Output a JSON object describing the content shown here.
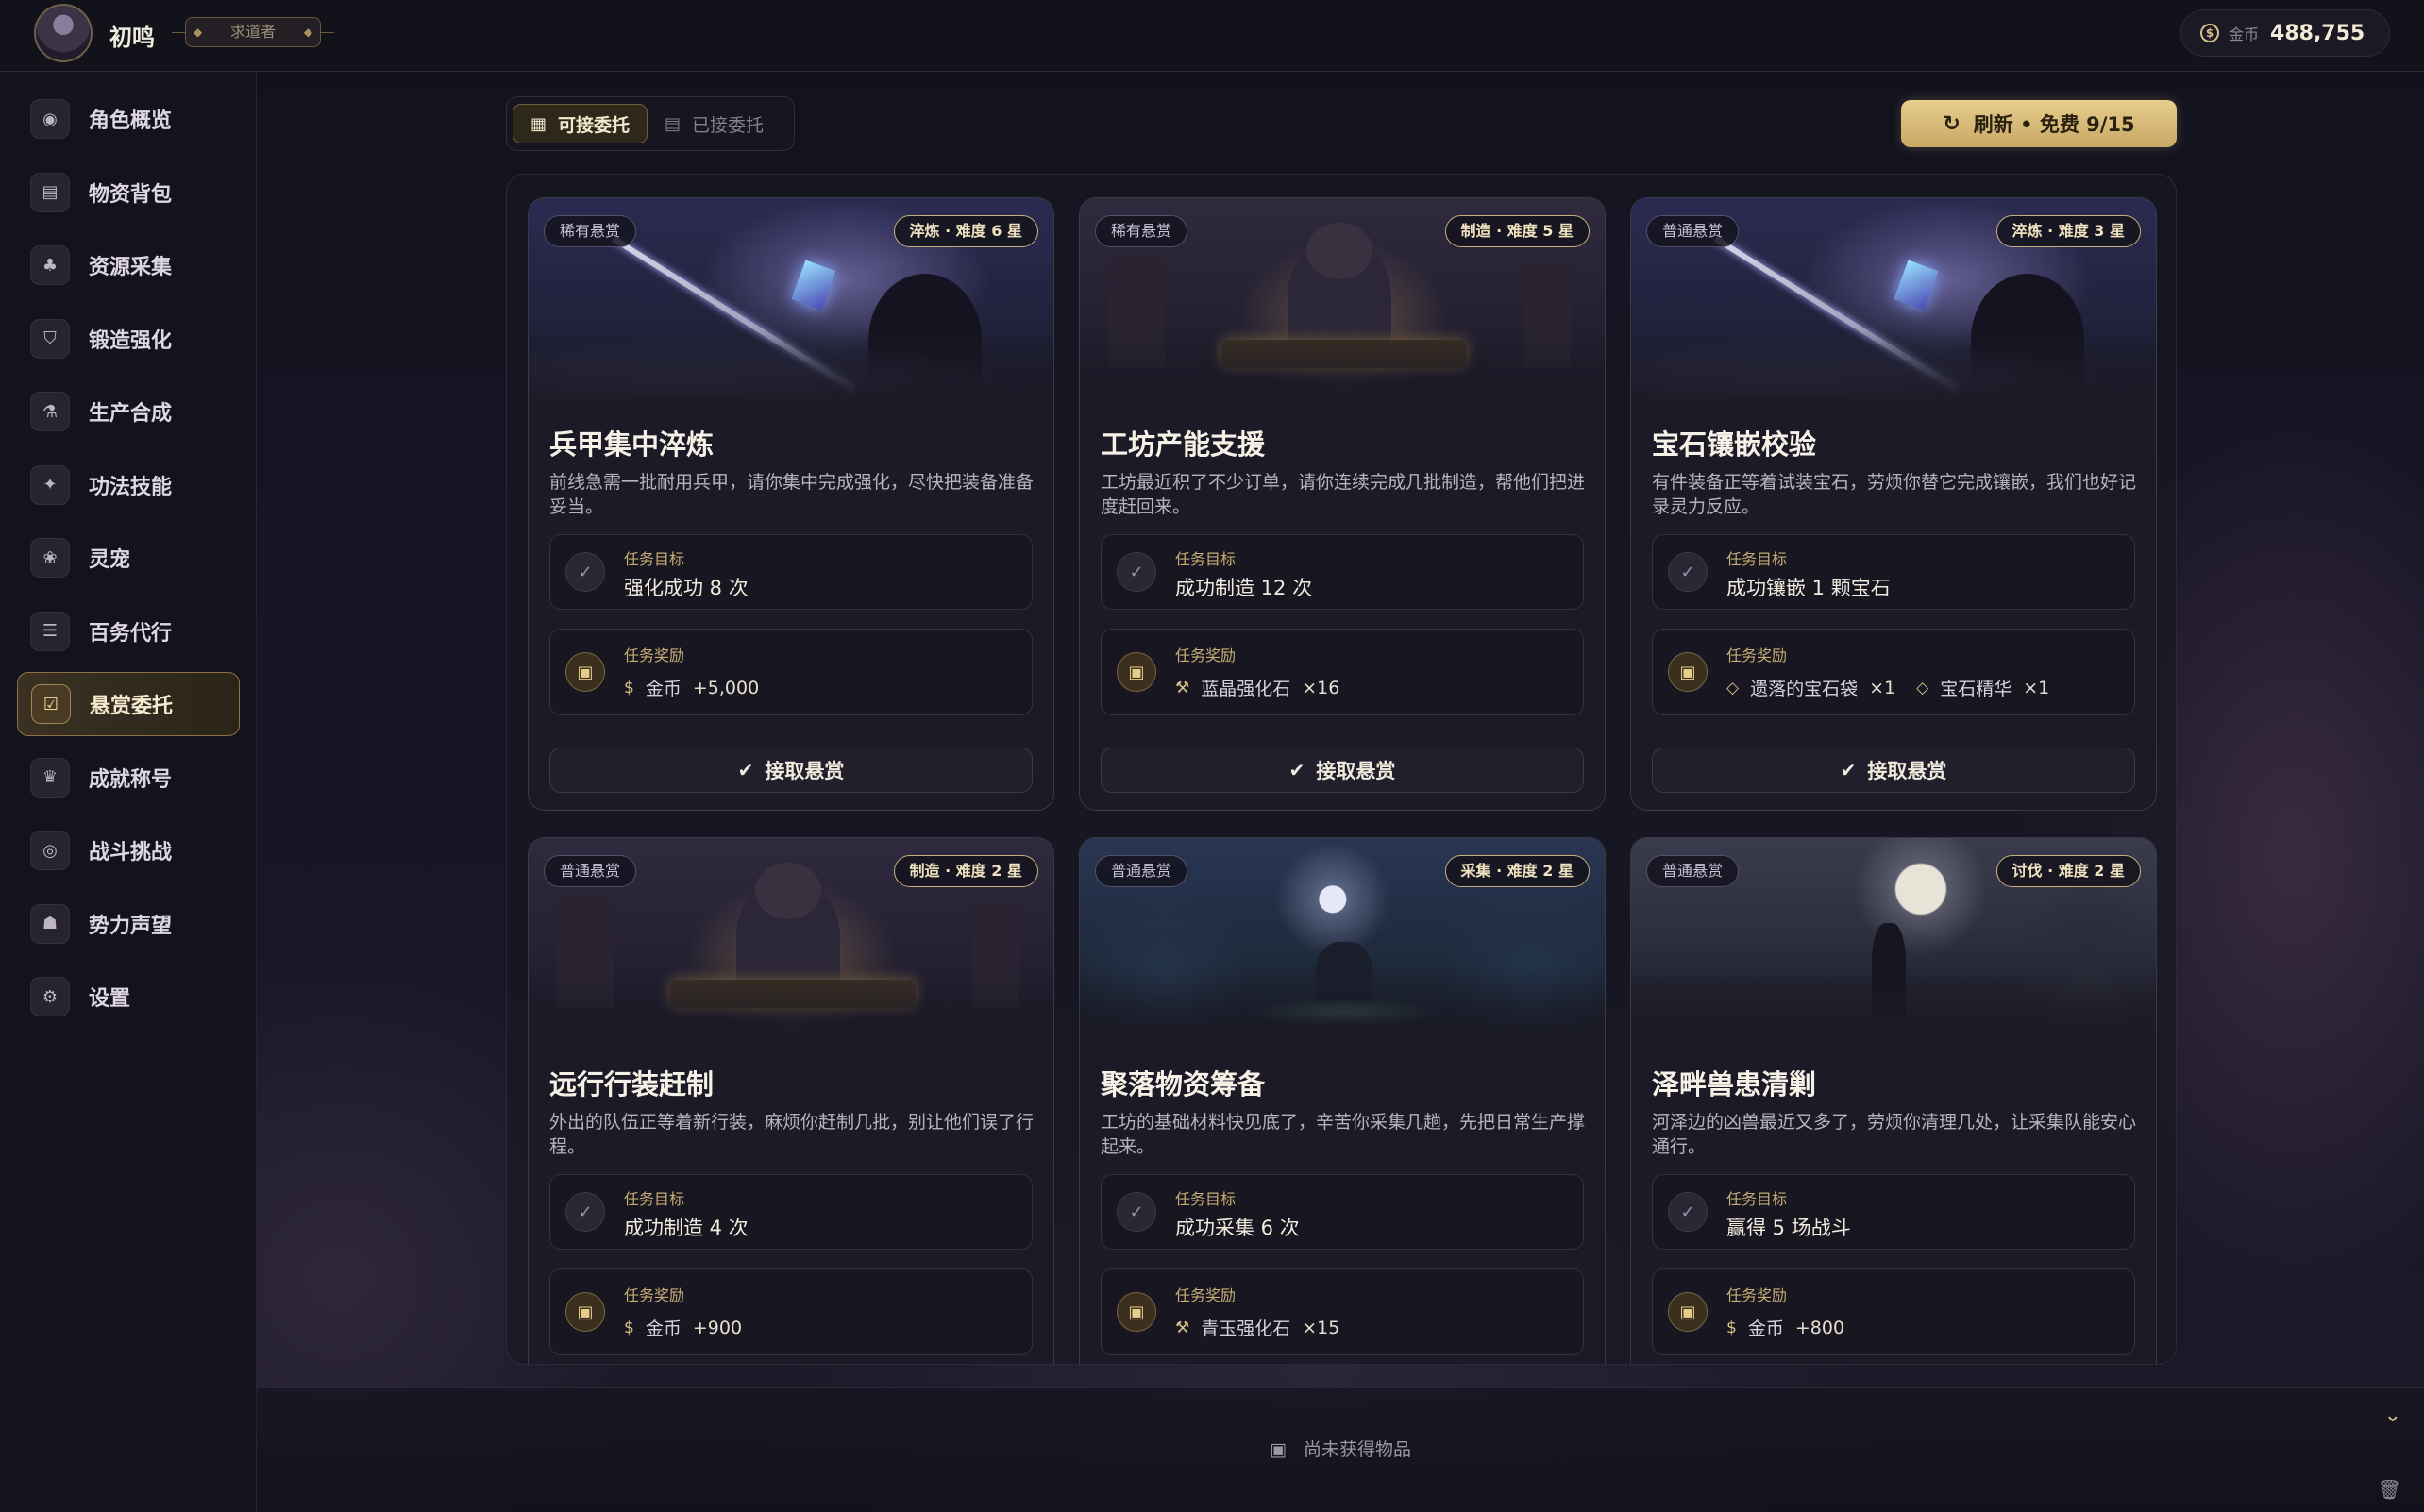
{
  "header": {
    "player_name": "初鸣",
    "player_title": "求道者",
    "coin_label": "金币",
    "coin_value": "488,755",
    "coin_icon": "coin-icon"
  },
  "sidebar": {
    "items": [
      {
        "label": "角色概览",
        "icon": "person-icon"
      },
      {
        "label": "物资背包",
        "icon": "bag-icon"
      },
      {
        "label": "资源采集",
        "icon": "tree-icon"
      },
      {
        "label": "锻造强化",
        "icon": "shield-icon"
      },
      {
        "label": "生产合成",
        "icon": "flask-icon"
      },
      {
        "label": "功法技能",
        "icon": "sparkle-icon"
      },
      {
        "label": "灵宠",
        "icon": "paw-icon"
      },
      {
        "label": "百务代行",
        "icon": "checklist-icon"
      },
      {
        "label": "悬赏委托",
        "icon": "clipboard-check-icon",
        "active": true
      },
      {
        "label": "成就称号",
        "icon": "trophy-icon"
      },
      {
        "label": "战斗挑战",
        "icon": "target-icon"
      },
      {
        "label": "势力声望",
        "icon": "group-icon"
      },
      {
        "label": "设置",
        "icon": "gear-icon"
      }
    ]
  },
  "tabs": {
    "available": "可接委托",
    "accepted": "已接委托"
  },
  "refresh_button": "刷新 • 免费 9/15",
  "labels": {
    "goal": "任务目标",
    "reward": "任务奖励",
    "accept": "接取悬赏"
  },
  "quests": [
    {
      "rarity": "稀有悬赏",
      "difficulty": "淬炼 · 难度 6 星",
      "title": "兵甲集中淬炼",
      "desc": "前线急需一批耐用兵甲，请你集中完成强化，尽快把装备准备妥当。",
      "goal": "强化成功 8 次",
      "rewards": [
        {
          "icon": "coin-icon",
          "name": "金币",
          "amount": "+5,000"
        }
      ],
      "scene": "sword"
    },
    {
      "rarity": "稀有悬赏",
      "difficulty": "制造 · 难度 5 星",
      "title": "工坊产能支援",
      "desc": "工坊最近积了不少订单，请你连续完成几批制造，帮他们把进度赶回来。",
      "goal": "成功制造 12 次",
      "rewards": [
        {
          "icon": "wand-icon",
          "name": "蓝晶强化石",
          "amount": "×16"
        }
      ],
      "scene": "workshop"
    },
    {
      "rarity": "普通悬赏",
      "difficulty": "淬炼 · 难度 3 星",
      "title": "宝石镶嵌校验",
      "desc": "有件装备正等着试装宝石，劳烦你替它完成镶嵌，我们也好记录灵力反应。",
      "goal": "成功镶嵌 1 颗宝石",
      "rewards": [
        {
          "icon": "gem-icon",
          "name": "遗落的宝石袋",
          "amount": "×1"
        },
        {
          "icon": "gem-icon",
          "name": "宝石精华",
          "amount": "×1"
        }
      ],
      "scene": "sword"
    },
    {
      "rarity": "普通悬赏",
      "difficulty": "制造 · 难度 2 星",
      "title": "远行行装赶制",
      "desc": "外出的队伍正等着新行装，麻烦你赶制几批，别让他们误了行程。",
      "goal": "成功制造 4 次",
      "rewards": [
        {
          "icon": "coin-icon",
          "name": "金币",
          "amount": "+900"
        }
      ],
      "scene": "workshop"
    },
    {
      "rarity": "普通悬赏",
      "difficulty": "采集 · 难度 2 星",
      "title": "聚落物资筹备",
      "desc": "工坊的基础材料快见底了，辛苦你采集几趟，先把日常生产撑起来。",
      "goal": "成功采集 6 次",
      "rewards": [
        {
          "icon": "wand-icon",
          "name": "青玉强化石",
          "amount": "×15"
        }
      ],
      "scene": "forest"
    },
    {
      "rarity": "普通悬赏",
      "difficulty": "讨伐 · 难度 2 星",
      "title": "泽畔兽患清剿",
      "desc": "河泽边的凶兽最近又多了，劳烦你清理几处，让采集队能安心通行。",
      "goal": "赢得 5 场战斗",
      "rewards": [
        {
          "icon": "coin-icon",
          "name": "金币",
          "amount": "+800"
        }
      ],
      "scene": "moon"
    }
  ],
  "footer": {
    "empty_text": "尚未获得物品"
  }
}
